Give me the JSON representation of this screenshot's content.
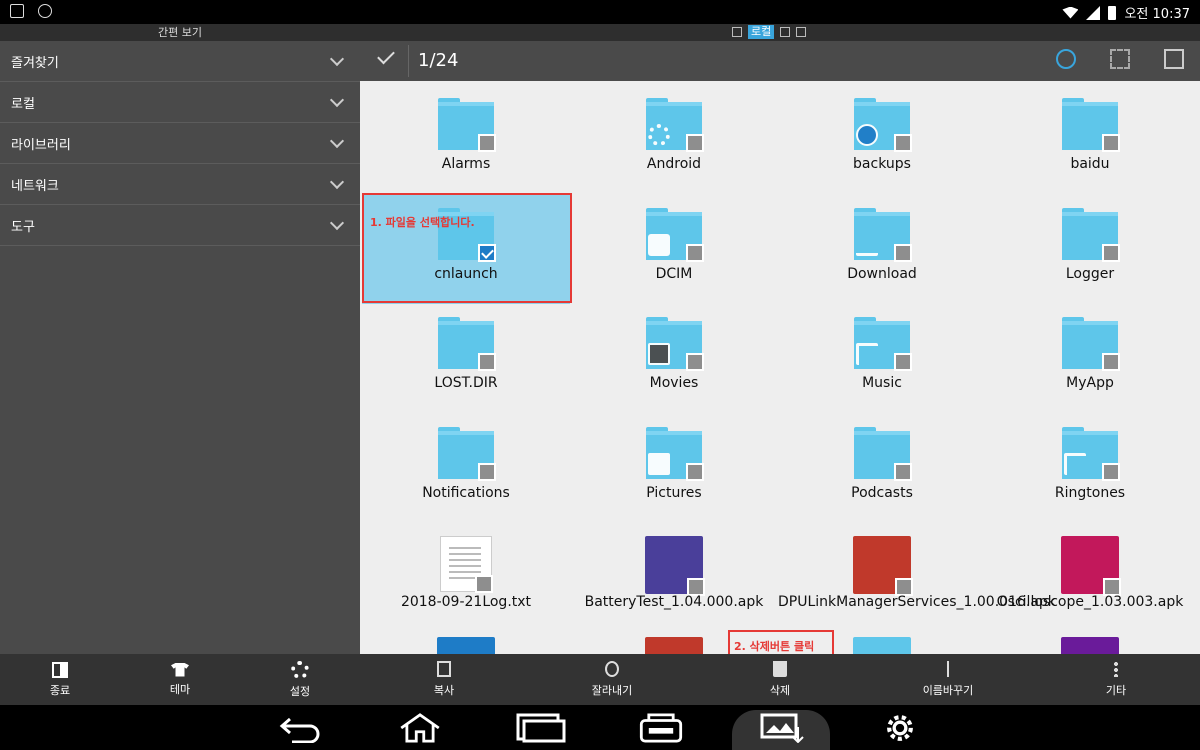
{
  "status_bar": {
    "time": "오전 10:37"
  },
  "sidebar": {
    "header": "간편 보기",
    "items": [
      {
        "label": "즐겨찾기"
      },
      {
        "label": "로컬"
      },
      {
        "label": "라이브러리"
      },
      {
        "label": "네트워크"
      },
      {
        "label": "도구"
      }
    ],
    "bottom": [
      {
        "label": "종료",
        "icon": "exit-icon"
      },
      {
        "label": "테마",
        "icon": "shirt-icon"
      },
      {
        "label": "설정",
        "icon": "gear-icon"
      }
    ]
  },
  "tabs": {
    "active_label": "로컬"
  },
  "action_bar": {
    "count": "1/24"
  },
  "files": [
    {
      "name": "Alarms",
      "type": "folder",
      "emblem": ""
    },
    {
      "name": "Android",
      "type": "folder",
      "emblem": "gear-icon"
    },
    {
      "name": "backups",
      "type": "folder",
      "emblem": "es-icon"
    },
    {
      "name": "baidu",
      "type": "folder",
      "emblem": ""
    },
    {
      "name": "cnlaunch",
      "type": "folder",
      "emblem": "",
      "selected": true
    },
    {
      "name": "DCIM",
      "type": "folder",
      "emblem": "camera-icon"
    },
    {
      "name": "Download",
      "type": "folder",
      "emblem": "download-icon"
    },
    {
      "name": "Logger",
      "type": "folder",
      "emblem": ""
    },
    {
      "name": "LOST.DIR",
      "type": "folder",
      "emblem": ""
    },
    {
      "name": "Movies",
      "type": "folder",
      "emblem": "play-icon"
    },
    {
      "name": "Music",
      "type": "folder",
      "emblem": "music-icon"
    },
    {
      "name": "MyApp",
      "type": "folder",
      "emblem": ""
    },
    {
      "name": "Notifications",
      "type": "folder",
      "emblem": ""
    },
    {
      "name": "Pictures",
      "type": "folder",
      "emblem": "picture-icon"
    },
    {
      "name": "Podcasts",
      "type": "folder",
      "emblem": ""
    },
    {
      "name": "Ringtones",
      "type": "folder",
      "emblem": "music-icon"
    },
    {
      "name": "2018-09-21Log.txt",
      "type": "txt"
    },
    {
      "name": "BatteryTest_1.04.000.apk",
      "type": "apk",
      "color": "#4a3f9a"
    },
    {
      "name": "DPULinkManagerServices_1.00.016.apk",
      "type": "apk",
      "color": "#c0392b"
    },
    {
      "name": "Oscilloscope_1.03.003.apk",
      "type": "apk",
      "color": "#c2185b"
    }
  ],
  "annotations": {
    "step1": "1. 파일을 선택합니다.",
    "step2": "2. 삭제버튼 클릭"
  },
  "bottom_actions": [
    {
      "label": "복사",
      "icon": "copy-icon"
    },
    {
      "label": "잘라내기",
      "icon": "cut-icon"
    },
    {
      "label": "삭제",
      "icon": "trash-icon"
    },
    {
      "label": "이름바꾸기",
      "icon": "rename-icon"
    },
    {
      "label": "기타",
      "icon": "more-icon"
    }
  ]
}
